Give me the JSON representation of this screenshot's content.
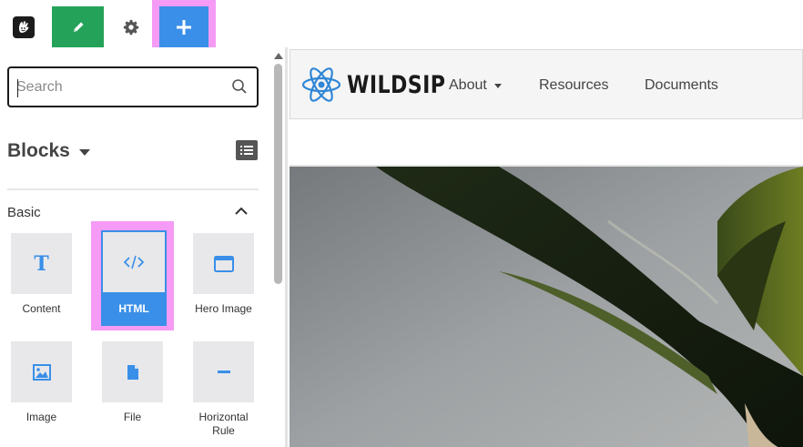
{
  "toolbar": {
    "logo_icon": "concrete-hand-icon",
    "edit_icon": "pencil-icon",
    "settings_icon": "gear-icon",
    "add_icon": "plus-icon",
    "edit_color": "#25a25a",
    "add_color": "#3a8fe8",
    "highlight_color": "#f59bf5"
  },
  "sidebar": {
    "search": {
      "placeholder": "Search",
      "value": ""
    },
    "section_title": "Blocks",
    "group": "Basic",
    "blocks": [
      {
        "label": "Content",
        "icon": "text-T-icon"
      },
      {
        "label": "HTML",
        "icon": "code-icon",
        "selected": true
      },
      {
        "label": "Hero Image",
        "icon": "window-icon"
      },
      {
        "label": "Image",
        "icon": "image-icon"
      },
      {
        "label": "File",
        "icon": "file-icon"
      },
      {
        "label": "Horizontal\nRule",
        "label_line1": "Horizontal",
        "label_line2": "Rule",
        "icon": "minus-icon"
      }
    ]
  },
  "preview": {
    "brand": "WILDSIP",
    "nav": [
      {
        "label": "About",
        "dropdown": true
      },
      {
        "label": "Resources"
      },
      {
        "label": "Documents"
      }
    ]
  }
}
